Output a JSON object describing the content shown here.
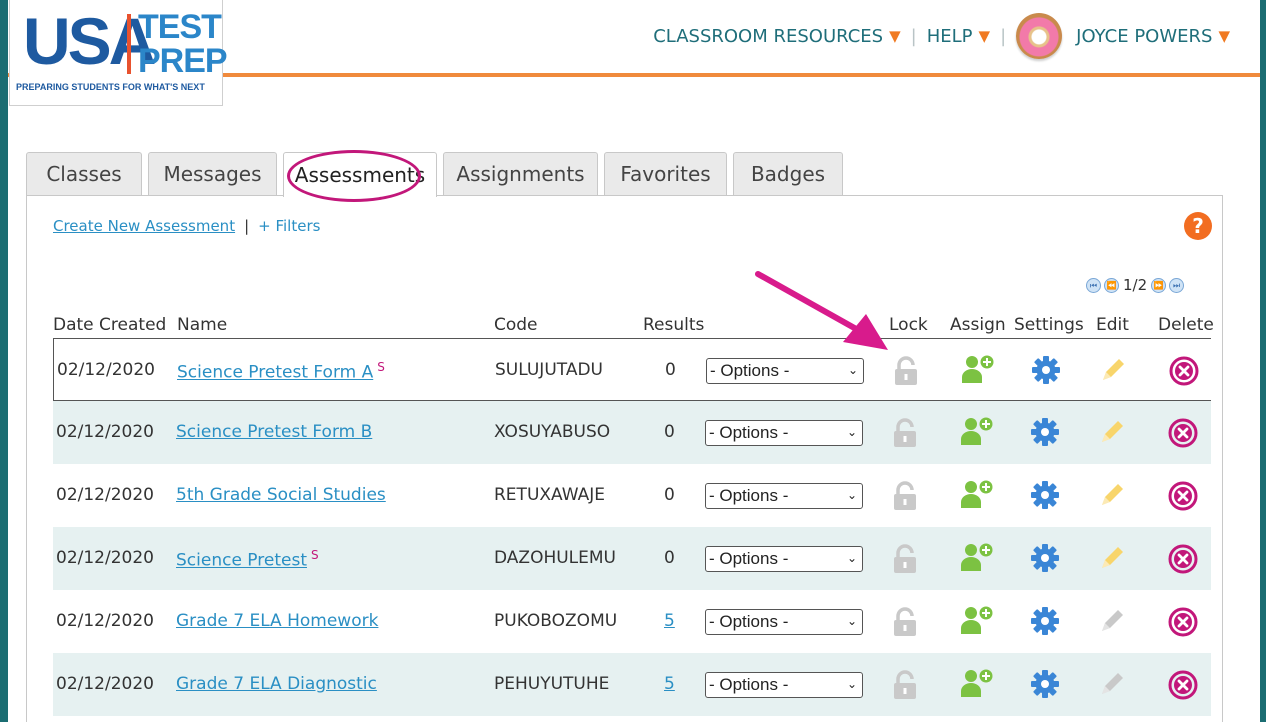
{
  "header": {
    "logo": {
      "usa": "USA",
      "test": "TEST",
      "prep": "PREP",
      "tagline": "PREPARING STUDENTS FOR WHAT'S NEXT"
    },
    "nav": {
      "classroom_resources": "CLASSROOM RESOURCES",
      "help": "HELP",
      "user_name": "JOYCE POWERS",
      "separator": "|",
      "caret": "▼"
    }
  },
  "tabs": [
    "Classes",
    "Messages",
    "Assessments",
    "Assignments",
    "Favorites",
    "Badges"
  ],
  "active_tab": "Assessments",
  "toolbar": {
    "create": "Create New Assessment",
    "separator": "|",
    "filters": "+ Filters",
    "help": "?"
  },
  "pager": {
    "label": "1/2"
  },
  "columns": {
    "date": "Date Created",
    "name": "Name",
    "code": "Code",
    "results": "Results",
    "lock": "Lock",
    "assign": "Assign",
    "settings": "Settings",
    "edit": "Edit",
    "delete": "Delete"
  },
  "options_label": "- Options -",
  "rows": [
    {
      "date": "02/12/2020",
      "name": "Science Pretest Form A",
      "marker": "S",
      "code": "SULUJUTADU",
      "results": "0",
      "editable": true
    },
    {
      "date": "02/12/2020",
      "name": "Science Pretest Form B",
      "marker": "",
      "code": "XOSUYABUSO",
      "results": "0",
      "editable": true
    },
    {
      "date": "02/12/2020",
      "name": "5th Grade Social Studies",
      "marker": "",
      "code": "RETUXAWAJE",
      "results": "0",
      "editable": true
    },
    {
      "date": "02/12/2020",
      "name": "Science Pretest",
      "marker": "S",
      "code": "DAZOHULEMU",
      "results": "0",
      "editable": true
    },
    {
      "date": "02/12/2020",
      "name": "Grade 7 ELA Homework",
      "marker": "",
      "code": "PUKOBOZOMU",
      "results": "5",
      "editable": false
    },
    {
      "date": "02/12/2020",
      "name": "Grade 7 ELA Diagnostic",
      "marker": "",
      "code": "PEHUYUTUHE",
      "results": "5",
      "editable": false
    }
  ],
  "colors": {
    "accent_orange": "#f08a3c",
    "link_blue": "#2a8fc4",
    "highlight_magenta": "#c2177a",
    "assign_green": "#7cc242",
    "settings_blue": "#3a86d6",
    "edit_yellow": "#f8d56b",
    "edit_gray": "#c9c9c9",
    "delete_magenta": "#c2177a"
  }
}
